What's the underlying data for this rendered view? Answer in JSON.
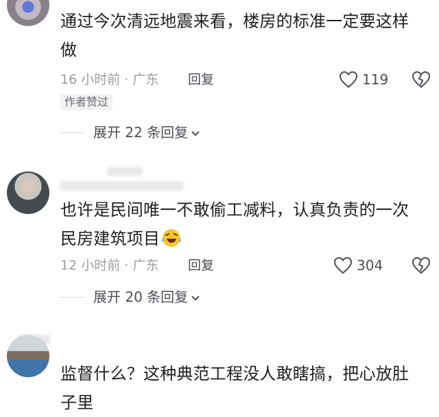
{
  "comments": [
    {
      "text": "通过今次清远地震来看，楼房的标准一定要这样做",
      "time": "16 小时前 · 广东",
      "reply_label": "回复",
      "likes": "119",
      "badge": "作者赞过",
      "expand": "展开 22 条回复"
    },
    {
      "text": "也许是民间唯一不敢偷工减料，认真负责的一次民房建筑项目",
      "time": "12 小时前 · 广东",
      "reply_label": "回复",
      "likes": "304",
      "emoji": "laughing-crying-emoji",
      "expand": "展开 20 条回复"
    },
    {
      "text": "监督什么？这种典范工程没人敢瞎搞，把心放肚子里"
    }
  ],
  "colors": {
    "text": "#1f1f1f",
    "meta": "#9c9ca3",
    "action": "#4d4d57",
    "badge_bg": "#f2f2f4"
  }
}
